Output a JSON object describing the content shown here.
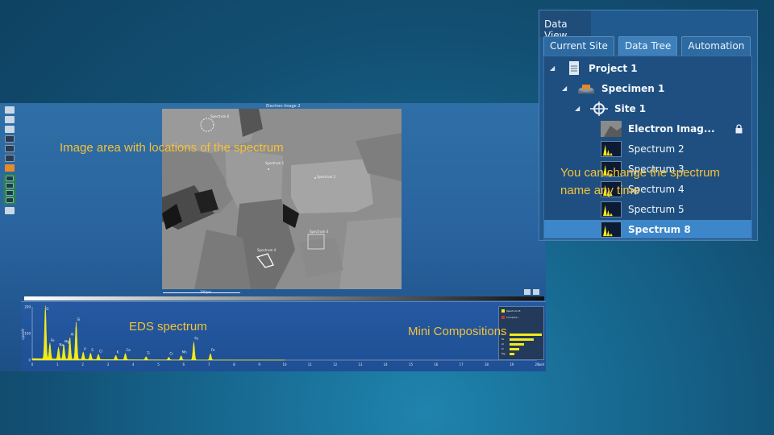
{
  "app": {
    "sem_image_title": "Electron Image 2",
    "scale_label": "100µm",
    "sem_labels": [
      "Spectrum 8",
      "Spectrum 1",
      "Spectrum 2",
      "Spectrum 4",
      "Spectrum 4"
    ]
  },
  "spectrum_panel": {
    "y_ticks": [
      "200",
      "100",
      "0"
    ],
    "y_axis_label": "cps/eV",
    "x_ticks": [
      "0",
      "1",
      "2",
      "3",
      "4",
      "5",
      "6",
      "7",
      "8",
      "9",
      "10",
      "11",
      "12",
      "13",
      "14",
      "15",
      "16",
      "17",
      "18",
      "19",
      "20"
    ],
    "x_unit": "keV",
    "peak_labels": [
      "O",
      "Fe",
      "Na",
      "Mg",
      "Al",
      "Si",
      "P",
      "S",
      "Cl",
      "K",
      "Ca",
      "Ti",
      "Cr",
      "Mn",
      "Fe",
      "Fe"
    ],
    "accent_color": "#f2ea1c"
  },
  "mini_composition": {
    "series": [
      {
        "name": "Spectrum 8",
        "color": "#f2ea1c"
      },
      {
        "name": "Compare...",
        "color": "#c0392b"
      }
    ],
    "elements": [
      "O",
      "Fe",
      "Al",
      "Si",
      "Mg"
    ]
  },
  "data_view": {
    "title": "Data View",
    "tabs": [
      "Current Site",
      "Data Tree",
      "Automation"
    ],
    "active_tab": "Data Tree",
    "tree": [
      {
        "label": "Project 1",
        "level": 0,
        "icon": "document-icon",
        "bold": true
      },
      {
        "label": "Specimen 1",
        "level": 1,
        "icon": "specimen-icon",
        "bold": true
      },
      {
        "label": "Site 1",
        "level": 2,
        "icon": "crosshair-icon",
        "bold": true
      },
      {
        "label": "Electron Imag...",
        "level": 3,
        "icon": "electron-image-icon",
        "bold": true
      },
      {
        "label": "Spectrum 2",
        "level": 3,
        "icon": "spectrum-icon",
        "bold": false
      },
      {
        "label": "Spectrum 3",
        "level": 3,
        "icon": "spectrum-icon",
        "bold": false
      },
      {
        "label": "Spectrum 4",
        "level": 3,
        "icon": "spectrum-icon",
        "bold": false
      },
      {
        "label": "Spectrum 5",
        "level": 3,
        "icon": "spectrum-icon",
        "bold": false
      },
      {
        "label": "Spectrum 8",
        "level": 3,
        "icon": "spectrum-icon",
        "bold": true,
        "selected": true
      }
    ]
  },
  "annotations": {
    "image_area": "Image area with locations of the spectrum",
    "eds": "EDS spectrum",
    "mini": "Mini Compositions",
    "rename": "You can change the spectrum name any time",
    "color": "#f4c13a"
  }
}
